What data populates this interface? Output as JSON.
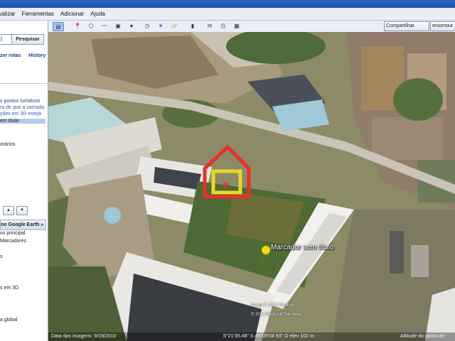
{
  "menu": [
    "ualizar",
    "Ferramentas",
    "Adicionar",
    "Ajuda"
  ],
  "search": {
    "input_value": "lo)",
    "button": "Pesquisar"
  },
  "links": [
    "zer rotas",
    "History"
  ],
  "places": [
    {
      "text": "s pontos turísticos",
      "kind": "link"
    },
    {
      "text": "ra de que a camada",
      "kind": "note"
    },
    {
      "text": "ções em 3D esteja",
      "kind": "note"
    },
    {
      "text": "em título",
      "kind": "selected"
    },
    {
      "text": "orários",
      "kind": "plain"
    }
  ],
  "nav": {
    "up": "▲",
    "down": "▼"
  },
  "layers": {
    "header": "no Google Earth »",
    "items": [
      "os principal",
      "Marcadores",
      "",
      "s",
      "",
      "s em 3D",
      "",
      "a global"
    ]
  },
  "toolbar": {
    "icons": [
      "sidebar-icon",
      "placemark-icon",
      "polygon-icon",
      "path-icon",
      "overlay-icon",
      "tour-icon",
      "history-icon",
      "sun-icon",
      "planets-icon",
      "ruler-icon",
      "email-icon",
      "print-icon",
      "maps-icon"
    ],
    "share_label": "Compartilhar",
    "user_label": "eniomour"
  },
  "map": {
    "placemark_label": "Marcador sem título",
    "credit_1": "Image © 2012 GeoEye",
    "credit_2": "© 2012 MapLink/Tele Atlas",
    "status_date": "Data das imagens: 9/19/2010",
    "status_coords": "5°21'35.48\" S   49°05'04.93\" O  elev  102 m",
    "status_altitude": "Altitude do ponto de"
  }
}
